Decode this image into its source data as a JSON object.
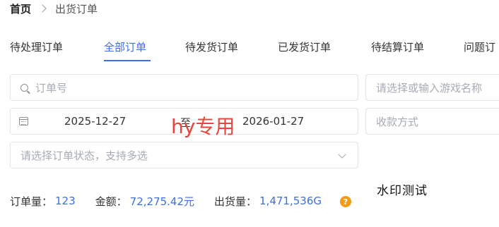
{
  "breadcrumb": {
    "home": "首页",
    "current": "出货订单"
  },
  "tabs": [
    {
      "label": "待处理订单"
    },
    {
      "label": "全部订单"
    },
    {
      "label": "待发货订单"
    },
    {
      "label": "已发货订单"
    },
    {
      "label": "待结算订单"
    },
    {
      "label": "问题订"
    }
  ],
  "active_tab": "全部订单",
  "filters": {
    "order_no_placeholder": "订单号",
    "game_placeholder": "请选择或输入游戏名称",
    "date_start": "2025-12-27",
    "date_separator": "至",
    "date_end": "2026-01-27",
    "payment_placeholder": "收款方式",
    "status_placeholder": "请选择订单状态，支持多选"
  },
  "stats": {
    "order_count_label": "订单量：",
    "order_count_value": "123",
    "amount_label": "金额：",
    "amount_value": "72,275.42元",
    "shipment_label": "出货量：",
    "shipment_value": "1,471,536G",
    "help_symbol": "?"
  },
  "overlays": {
    "red_mark": "hy专用",
    "test_mark": "水印测试"
  },
  "colors": {
    "accent": "#3b6ee8",
    "warning": "#f39a17",
    "overlay_red": "#e8453c"
  }
}
